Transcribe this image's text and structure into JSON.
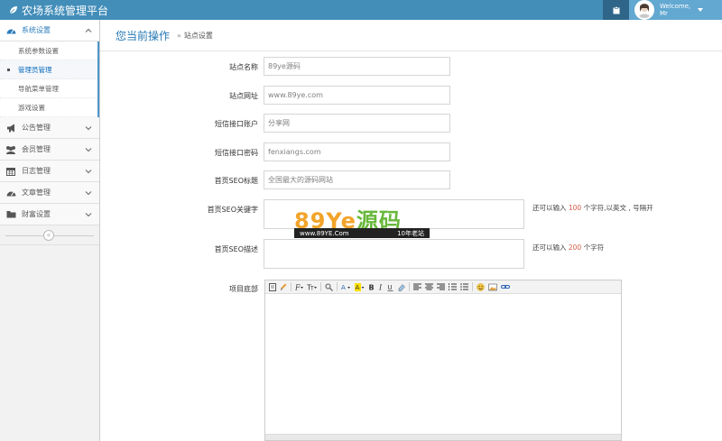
{
  "app": {
    "title": "农场系统管理平台"
  },
  "user": {
    "welcome": "Welcome,",
    "name": "Mr"
  },
  "sidebar": {
    "groups": [
      {
        "label": "系统设置",
        "icon": "tachometer-icon",
        "open": true,
        "items": [
          {
            "label": "系统参数设置"
          },
          {
            "label": "管理员管理",
            "active": true
          },
          {
            "label": "导航菜单管理"
          },
          {
            "label": "游戏设置"
          }
        ]
      },
      {
        "label": "公告管理",
        "icon": "bullhorn-icon"
      },
      {
        "label": "会员管理",
        "icon": "users-icon"
      },
      {
        "label": "日志管理",
        "icon": "calendar-icon"
      },
      {
        "label": "文章管理",
        "icon": "gauge-icon"
      },
      {
        "label": "财富设置",
        "icon": "folder-icon"
      }
    ]
  },
  "breadcrumb": {
    "main": "您当前操作",
    "sep": "»",
    "sub": "站点设置"
  },
  "form": {
    "site_name": {
      "label": "站点名称",
      "value": "89ye源码"
    },
    "site_url": {
      "label": "站点网址",
      "value": "www.89ye.com"
    },
    "sms_account": {
      "label": "短信接口账户",
      "value": "分享网"
    },
    "sms_password": {
      "label": "短信接口密码",
      "value": "fenxiangs.com"
    },
    "seo_title": {
      "label": "首页SEO标题",
      "value": "全国最大的源码网站"
    },
    "seo_keywords": {
      "label": "首页SEO关键字",
      "value": "",
      "hint_prefix": "还可以输入",
      "hint_count": "100",
      "hint_suffix": "个字符,以英文 , 号隔开"
    },
    "seo_desc": {
      "label": "首页SEO描述",
      "value": "",
      "hint_prefix": "还可以输入",
      "hint_count": "200",
      "hint_suffix": "个字符"
    },
    "footer": {
      "label": "项目底部"
    }
  },
  "watermark": {
    "big_latin": "89Ye",
    "big_han": "源码",
    "url": "www.89YE.Com",
    "tag": "10年老站"
  },
  "colors": {
    "topbar": "#438eb9",
    "accent": "#2679b5",
    "hint_red": "#d15b47"
  }
}
